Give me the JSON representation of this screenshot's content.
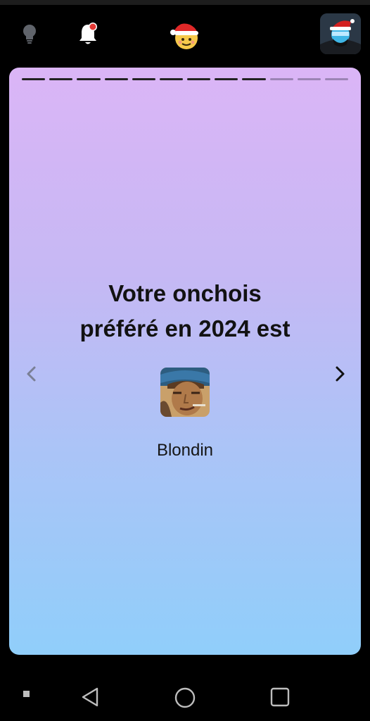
{
  "app": {
    "center_icon": "santa-hat-emoji-icon",
    "left_icons": [
      "lightbulb-icon",
      "bell-icon"
    ],
    "notification_dot_color": "#e53935",
    "profile_avatar": "profile-avatar-santa-hat"
  },
  "story": {
    "progress": {
      "total_segments": 12,
      "completed_segments": 9
    },
    "headline_line1": "Votre onchois",
    "headline_line2": "préféré en 2024 est",
    "winner_name": "Blondin",
    "prev_icon": "chevron-left-icon",
    "next_icon": "chevron-right-icon",
    "gradient": {
      "top": "#dbb5f6",
      "bottom": "#90cefa"
    }
  },
  "system_nav": {
    "buttons": [
      "recent-square-dot-icon",
      "back-triangle-icon",
      "home-circle-icon",
      "overview-square-icon"
    ]
  }
}
